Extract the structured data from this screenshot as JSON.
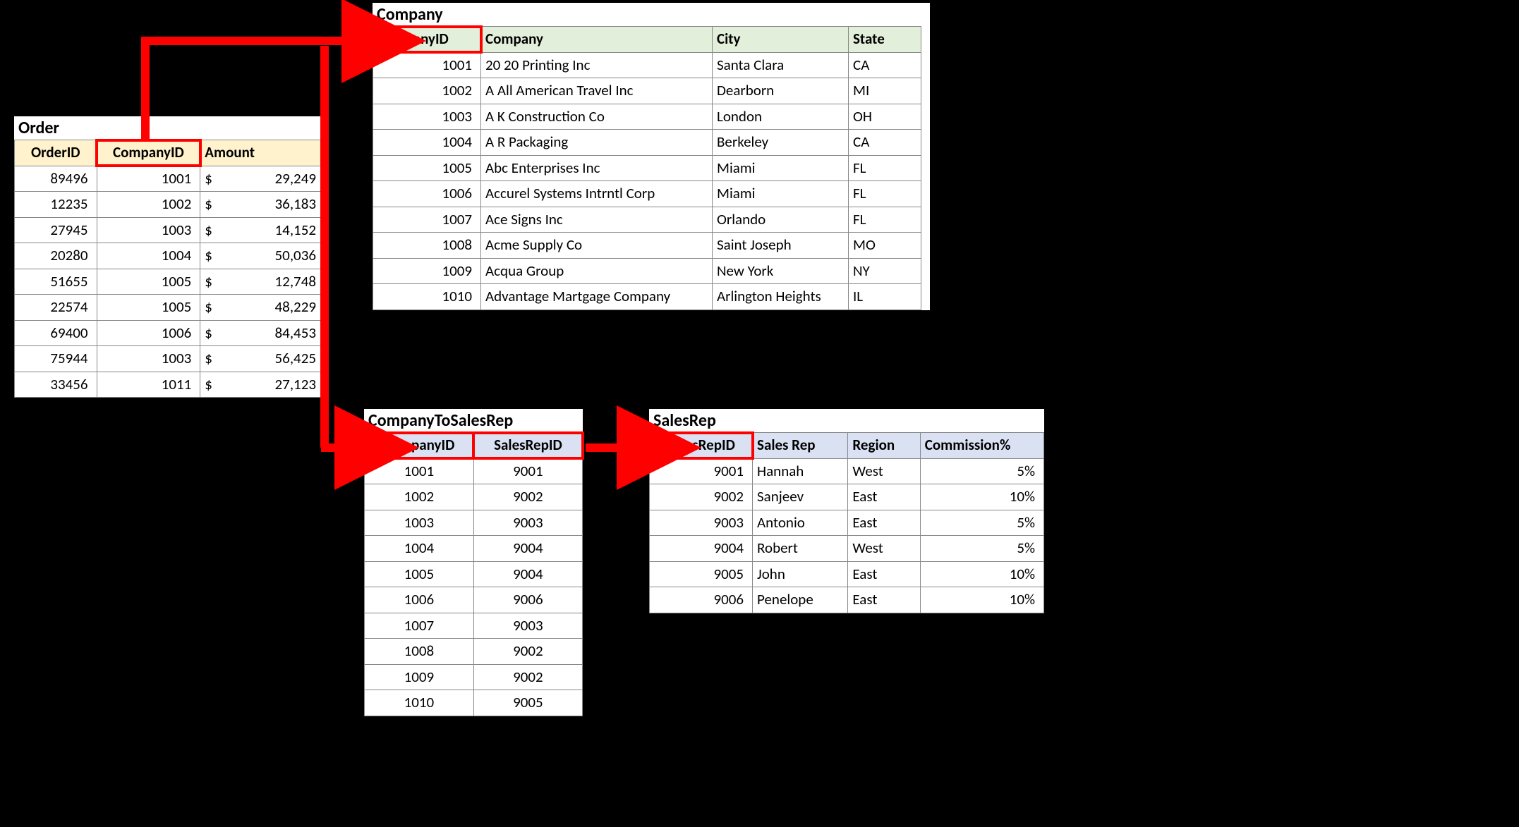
{
  "order": {
    "title": "Order",
    "headers": [
      "OrderID",
      "CompanyID",
      "Amount"
    ],
    "rows": [
      {
        "orderId": "89496",
        "companyId": "1001",
        "amount": "29,249"
      },
      {
        "orderId": "12235",
        "companyId": "1002",
        "amount": "36,183"
      },
      {
        "orderId": "27945",
        "companyId": "1003",
        "amount": "14,152"
      },
      {
        "orderId": "20280",
        "companyId": "1004",
        "amount": "50,036"
      },
      {
        "orderId": "51655",
        "companyId": "1005",
        "amount": "12,748"
      },
      {
        "orderId": "22574",
        "companyId": "1005",
        "amount": "48,229"
      },
      {
        "orderId": "69400",
        "companyId": "1006",
        "amount": "84,453"
      },
      {
        "orderId": "75944",
        "companyId": "1003",
        "amount": "56,425"
      },
      {
        "orderId": "33456",
        "companyId": "1011",
        "amount": "27,123"
      }
    ]
  },
  "company": {
    "title": "Company",
    "headers": [
      "CompanyID",
      "Company",
      "City",
      "State"
    ],
    "rows": [
      {
        "id": "1001",
        "name": "20 20 Printing Inc",
        "city": "Santa Clara",
        "state": "CA"
      },
      {
        "id": "1002",
        "name": "A All American Travel Inc",
        "city": "Dearborn",
        "state": "MI"
      },
      {
        "id": "1003",
        "name": "A K Construction Co",
        "city": "London",
        "state": "OH"
      },
      {
        "id": "1004",
        "name": "A R Packaging",
        "city": "Berkeley",
        "state": "CA"
      },
      {
        "id": "1005",
        "name": "Abc Enterprises Inc",
        "city": "Miami",
        "state": "FL"
      },
      {
        "id": "1006",
        "name": "Accurel Systems Intrntl Corp",
        "city": "Miami",
        "state": "FL"
      },
      {
        "id": "1007",
        "name": "Ace Signs Inc",
        "city": "Orlando",
        "state": "FL"
      },
      {
        "id": "1008",
        "name": "Acme Supply Co",
        "city": "Saint Joseph",
        "state": "MO"
      },
      {
        "id": "1009",
        "name": "Acqua Group",
        "city": "New York",
        "state": "NY"
      },
      {
        "id": "1010",
        "name": "Advantage Martgage Company",
        "city": "Arlington Heights",
        "state": "IL"
      }
    ]
  },
  "c2s": {
    "title": "CompanyToSalesRep",
    "headers": [
      "CompanyID",
      "SalesRepID"
    ],
    "rows": [
      {
        "cid": "1001",
        "sid": "9001"
      },
      {
        "cid": "1002",
        "sid": "9002"
      },
      {
        "cid": "1003",
        "sid": "9003"
      },
      {
        "cid": "1004",
        "sid": "9004"
      },
      {
        "cid": "1005",
        "sid": "9004"
      },
      {
        "cid": "1006",
        "sid": "9006"
      },
      {
        "cid": "1007",
        "sid": "9003"
      },
      {
        "cid": "1008",
        "sid": "9002"
      },
      {
        "cid": "1009",
        "sid": "9002"
      },
      {
        "cid": "1010",
        "sid": "9005"
      }
    ]
  },
  "salesrep": {
    "title": "SalesRep",
    "headers": [
      "SalesRepID",
      "Sales Rep",
      "Region",
      "Commission%"
    ],
    "rows": [
      {
        "id": "9001",
        "name": "Hannah",
        "region": "West",
        "comm": "5%"
      },
      {
        "id": "9002",
        "name": "Sanjeev",
        "region": "East",
        "comm": "10%"
      },
      {
        "id": "9003",
        "name": "Antonio",
        "region": "East",
        "comm": "5%"
      },
      {
        "id": "9004",
        "name": "Robert",
        "region": "West",
        "comm": "5%"
      },
      {
        "id": "9005",
        "name": "John",
        "region": "East",
        "comm": "10%"
      },
      {
        "id": "9006",
        "name": "Penelope",
        "region": "East",
        "comm": "10%"
      }
    ]
  },
  "chart_data": {
    "type": "table",
    "note": "Entity-relationship diagram with four tables; CompanyID links Order→Company and Order→CompanyToSalesRep; SalesRepID links CompanyToSalesRep→SalesRep.",
    "tables": {
      "Order": {
        "columns": [
          "OrderID",
          "CompanyID",
          "Amount"
        ],
        "rows": [
          [
            89496,
            1001,
            29249
          ],
          [
            12235,
            1002,
            36183
          ],
          [
            27945,
            1003,
            14152
          ],
          [
            20280,
            1004,
            50036
          ],
          [
            51655,
            1005,
            12748
          ],
          [
            22574,
            1005,
            48229
          ],
          [
            69400,
            1006,
            84453
          ],
          [
            75944,
            1003,
            56425
          ],
          [
            33456,
            1011,
            27123
          ]
        ]
      },
      "Company": {
        "columns": [
          "CompanyID",
          "Company",
          "City",
          "State"
        ],
        "rows": [
          [
            1001,
            "20 20 Printing Inc",
            "Santa Clara",
            "CA"
          ],
          [
            1002,
            "A All American Travel Inc",
            "Dearborn",
            "MI"
          ],
          [
            1003,
            "A K Construction Co",
            "London",
            "OH"
          ],
          [
            1004,
            "A R Packaging",
            "Berkeley",
            "CA"
          ],
          [
            1005,
            "Abc Enterprises Inc",
            "Miami",
            "FL"
          ],
          [
            1006,
            "Accurel Systems Intrntl Corp",
            "Miami",
            "FL"
          ],
          [
            1007,
            "Ace Signs Inc",
            "Orlando",
            "FL"
          ],
          [
            1008,
            "Acme Supply Co",
            "Saint Joseph",
            "MO"
          ],
          [
            1009,
            "Acqua Group",
            "New York",
            "NY"
          ],
          [
            1010,
            "Advantage Martgage Company",
            "Arlington Heights",
            "IL"
          ]
        ]
      },
      "CompanyToSalesRep": {
        "columns": [
          "CompanyID",
          "SalesRepID"
        ],
        "rows": [
          [
            1001,
            9001
          ],
          [
            1002,
            9002
          ],
          [
            1003,
            9003
          ],
          [
            1004,
            9004
          ],
          [
            1005,
            9004
          ],
          [
            1006,
            9006
          ],
          [
            1007,
            9003
          ],
          [
            1008,
            9002
          ],
          [
            1009,
            9002
          ],
          [
            1010,
            9005
          ]
        ]
      },
      "SalesRep": {
        "columns": [
          "SalesRepID",
          "Sales Rep",
          "Region",
          "Commission%"
        ],
        "rows": [
          [
            9001,
            "Hannah",
            "West",
            5
          ],
          [
            9002,
            "Sanjeev",
            "East",
            10
          ],
          [
            9003,
            "Antonio",
            "East",
            5
          ],
          [
            9004,
            "Robert",
            "West",
            5
          ],
          [
            9005,
            "John",
            "East",
            10
          ],
          [
            9006,
            "Penelope",
            "East",
            10
          ]
        ]
      }
    },
    "relations": [
      {
        "from": "Order.CompanyID",
        "to": "Company.CompanyID"
      },
      {
        "from": "Order.CompanyID",
        "to": "CompanyToSalesRep.CompanyID"
      },
      {
        "from": "CompanyToSalesRep.SalesRepID",
        "to": "SalesRep.SalesRepID"
      }
    ]
  }
}
